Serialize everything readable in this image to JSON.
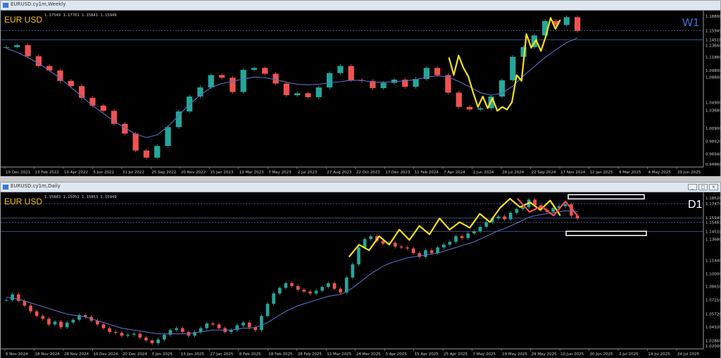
{
  "top": {
    "window_title": "EURUSD.cy1m,Weekly",
    "ohlc_text": "1.17549 1.17701 1.15841 1.15949",
    "symbol_label": "EUR USD",
    "timeframe_label": "W1",
    "price_axis": [
      "1.18800",
      "1.15949",
      "1.14518",
      "1.13660",
      "1.11860",
      "1.09800",
      "1.08800",
      "1.04900",
      "1.03680",
      "1.00900",
      "0.98920",
      "0.96940",
      "0.94960"
    ],
    "time_axis": [
      "19 Dec 2021",
      "13 Feb 2022",
      "10 Apr 2022",
      "5 Jun 2022",
      "31 Jul 2022",
      "25 Sep 2022",
      "20 Nov 2022",
      "15 Jan 2023",
      "12 Mar 2023",
      "7 May 2023",
      "2 Jul 2023",
      "27 Aug 2023",
      "22 Oct 2023",
      "17 Dec 2023",
      "11 Feb 2024",
      "7 Apr 2024",
      "2 Jun 2024",
      "28 Jul 2024",
      "22 Sep 2024",
      "17 Nov 2024",
      "12 Jan 2025",
      "9 Mar 2025",
      "4 May 2025",
      "29 Jun 2025"
    ],
    "colors": {
      "up": "#26a69a",
      "down": "#ef5350",
      "ma": "#5c6bc0",
      "zigzag": "#f5e11a",
      "label": "#f5c518",
      "tf": "#4a70d8"
    }
  },
  "bottom": {
    "window_title": "EURUSD.cy1m,Daily",
    "ohlc_text": "1.15883 1.15952 1.15853 1.15949",
    "symbol_label": "EUR USD",
    "timeframe_label": "D1",
    "price_axis": [
      "1.18520",
      "1.17474",
      "1.15949",
      "1.15481",
      "1.14510",
      "1.13680",
      "1.11440",
      "1.10000",
      "1.08650",
      "1.07210",
      "1.05720",
      "1.04320",
      "1.02860",
      "1.02000"
    ],
    "time_axis": [
      "6 Nov 2024",
      "18 Nov 2024",
      "28 Nov 2024",
      "10 Dec 2024",
      "20 Dec 2024",
      "3 Jan 2025",
      "15 Jan 2025",
      "27 Jan 2025",
      "6 Feb 2025",
      "18 Feb 2025",
      "28 Feb 2025",
      "12 Mar 2025",
      "24 Mar 2025",
      "3 Apr 2025",
      "15 Apr 2025",
      "25 Apr 2025",
      "7 May 2025",
      "19 May 2025",
      "29 May 2025",
      "10 Jun 2025",
      "20 Jun 2025",
      "2 Jul 2025",
      "14 Jul 2025",
      "24 Jul 2025"
    ]
  },
  "chart_data": [
    {
      "type": "candlestick",
      "title": "EURUSD.cy1m,Weekly",
      "x_range": [
        "19 Dec 2021",
        "29 Jun 2025"
      ],
      "ylim": [
        0.9496,
        1.188
      ],
      "series": [
        {
          "name": "",
          "values": [
            1.134,
            1.137,
            1.12,
            1.105,
            1.098,
            1.082,
            1.074,
            1.056,
            1.044,
            1.036,
            1.016,
            1.001,
            0.975,
            0.964,
            0.982,
            1.011,
            1.035,
            1.058,
            1.072,
            1.091,
            1.087,
            1.065,
            1.099,
            1.102,
            1.093,
            1.078,
            1.06,
            1.063,
            1.057,
            1.072,
            1.094,
            1.105,
            1.083,
            1.082,
            1.071,
            1.079,
            1.084,
            1.073,
            1.085,
            1.102,
            1.091,
            1.064,
            1.042,
            1.038,
            1.04,
            1.058,
            1.083,
            1.119,
            1.134,
            1.152,
            1.174,
            1.168,
            1.18,
            1.159
          ]
        }
      ],
      "moving_average": [
        1.132,
        1.126,
        1.118,
        1.109,
        1.098,
        1.086,
        1.072,
        1.058,
        1.044,
        1.032,
        1.02,
        1.01,
        1.0,
        0.995,
        0.999,
        1.012,
        1.029,
        1.046,
        1.06,
        1.072,
        1.078,
        1.081,
        1.085,
        1.088,
        1.087,
        1.084,
        1.08,
        1.077,
        1.076,
        1.077,
        1.079,
        1.081,
        1.083,
        1.083,
        1.08,
        1.08,
        1.081,
        1.082,
        1.084,
        1.088,
        1.09,
        1.088,
        1.081,
        1.073,
        1.064,
        1.06,
        1.063,
        1.074,
        1.09,
        1.104,
        1.118,
        1.13,
        1.141,
        1.148
      ],
      "zigzag": [
        1.118,
        1.091,
        1.121,
        1.102,
        1.089,
        1.064,
        1.042,
        1.058,
        1.04,
        1.055,
        1.036,
        1.042,
        1.038,
        1.049,
        1.091,
        1.082,
        1.154,
        1.133,
        1.145,
        1.128,
        1.15,
        1.179,
        1.162,
        1.176
      ],
      "horizontal_lines": [
        1.1595,
        1.1452
      ]
    },
    {
      "type": "candlestick",
      "title": "EURUSD.cy1m,Daily",
      "x_range": [
        "6 Nov 2024",
        "24 Jul 2025"
      ],
      "ylim": [
        1.02,
        1.1852
      ],
      "series": [
        {
          "name": "",
          "values": [
            1.072,
            1.078,
            1.071,
            1.066,
            1.06,
            1.055,
            1.052,
            1.046,
            1.049,
            1.043,
            1.048,
            1.051,
            1.056,
            1.054,
            1.05,
            1.046,
            1.042,
            1.038,
            1.037,
            1.034,
            1.035,
            1.036,
            1.032,
            1.029,
            1.026,
            1.03,
            1.035,
            1.04,
            1.042,
            1.038,
            1.034,
            1.038,
            1.042,
            1.047,
            1.046,
            1.042,
            1.038,
            1.04,
            1.045,
            1.048,
            1.043,
            1.04,
            1.055,
            1.068,
            1.079,
            1.085,
            1.09,
            1.087,
            1.083,
            1.081,
            1.079,
            1.082,
            1.086,
            1.09,
            1.084,
            1.08,
            1.096,
            1.11,
            1.128,
            1.137,
            1.14,
            1.135,
            1.132,
            1.133,
            1.129,
            1.128,
            1.127,
            1.122,
            1.118,
            1.125,
            1.122,
            1.128,
            1.131,
            1.134,
            1.14,
            1.138,
            1.143,
            1.145,
            1.15,
            1.155,
            1.159,
            1.161,
            1.158,
            1.165,
            1.169,
            1.171,
            1.179,
            1.173,
            1.168,
            1.166,
            1.17,
            1.172,
            1.174,
            1.162,
            1.159
          ]
        }
      ],
      "moving_average": [
        1.075,
        1.074,
        1.073,
        1.071,
        1.069,
        1.067,
        1.065,
        1.063,
        1.061,
        1.059,
        1.057,
        1.056,
        1.055,
        1.054,
        1.052,
        1.05,
        1.048,
        1.046,
        1.044,
        1.042,
        1.041,
        1.04,
        1.039,
        1.038,
        1.037,
        1.036,
        1.036,
        1.036,
        1.036,
        1.036,
        1.036,
        1.037,
        1.038,
        1.039,
        1.04,
        1.04,
        1.04,
        1.04,
        1.041,
        1.042,
        1.042,
        1.043,
        1.045,
        1.048,
        1.052,
        1.056,
        1.06,
        1.063,
        1.066,
        1.068,
        1.07,
        1.072,
        1.074,
        1.076,
        1.077,
        1.078,
        1.081,
        1.085,
        1.09,
        1.095,
        1.1,
        1.104,
        1.108,
        1.111,
        1.113,
        1.115,
        1.117,
        1.118,
        1.119,
        1.12,
        1.121,
        1.122,
        1.124,
        1.126,
        1.128,
        1.13,
        1.132,
        1.134,
        1.137,
        1.14,
        1.143,
        1.146,
        1.148,
        1.151,
        1.154,
        1.157,
        1.16,
        1.162,
        1.163,
        1.164,
        1.165,
        1.166,
        1.167,
        1.167,
        1.166
      ],
      "zigzag_yellow": [
        1.118,
        1.131,
        1.125,
        1.14,
        1.131,
        1.147,
        1.136,
        1.151,
        1.142,
        1.159,
        1.147,
        1.155,
        1.149,
        1.164,
        1.155,
        1.17,
        1.18,
        1.171,
        1.176,
        1.168,
        1.178,
        1.162
      ],
      "zigzag_red": [
        1.18,
        1.166,
        1.172,
        1.162,
        1.177,
        1.162
      ],
      "horizontal_lines": [
        1.1747,
        1.1595,
        1.1548,
        1.1452
      ]
    }
  ]
}
